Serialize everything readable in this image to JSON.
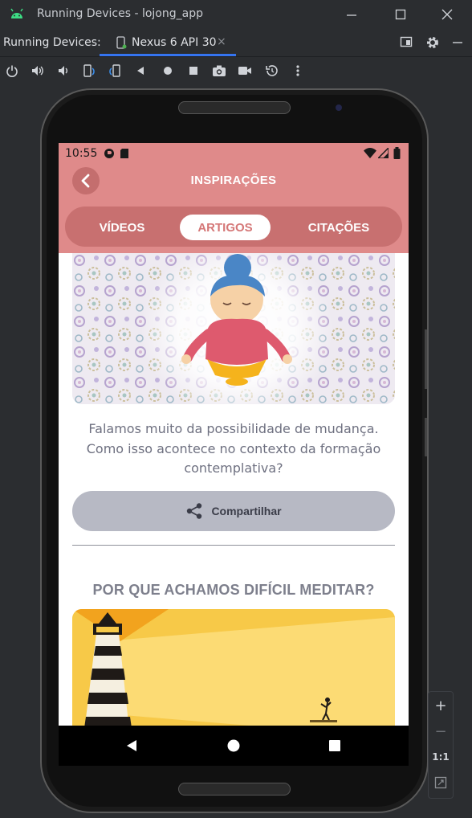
{
  "window": {
    "title": "Running Devices - lojong_app"
  },
  "tabbar": {
    "label": "Running Devices:",
    "tab_name": "Nexus 6 API 30"
  },
  "toolbar": {
    "tools": [
      "power-icon",
      "volume-up-icon",
      "volume-down-icon",
      "rotate-left-icon",
      "rotate-right-icon",
      "back-icon",
      "home-icon",
      "overview-icon",
      "screenshot-icon",
      "record-icon",
      "reset-icon",
      "more-icon"
    ]
  },
  "device": {
    "status": {
      "time": "10:55"
    },
    "app": {
      "title": "INSPIRAÇÕES",
      "tabs": [
        "VÍDEOS",
        "ARTIGOS",
        "CITAÇÕES"
      ],
      "selected_tab": "ARTIGOS",
      "article": {
        "text": "Falamos muito da possibilidade de mudança. Como isso acontece no contexto da formação contemplativa?",
        "share_label": "Compartilhar"
      },
      "next_article": {
        "title": "POR QUE ACHAMOS DIFÍCIL MEDITAR?"
      }
    }
  },
  "zoom": {
    "plus": "+",
    "minus": "−",
    "one_to_one": "1:1"
  },
  "colors": {
    "appbar": "#df8a8a",
    "segment_bg": "#c87070",
    "active_tab_text": "#d57777",
    "share_button": "#b7b9c4",
    "ide_accent": "#3574f0"
  }
}
